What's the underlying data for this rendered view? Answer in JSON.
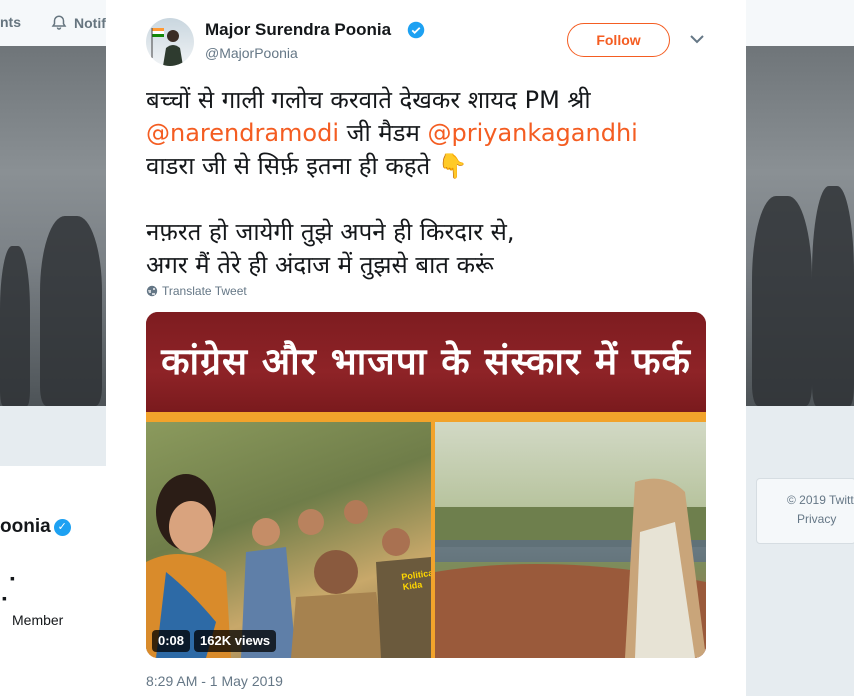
{
  "background": {
    "nav_items": [
      "nts",
      "Notifi"
    ],
    "profile_name": "oonia",
    "member_label": "Member",
    "footer_lines": [
      "© 2019 Twitt",
      "Privacy"
    ]
  },
  "tweet": {
    "display_name": "Major Surendra Poonia",
    "handle": "@MajorPoonia",
    "follow_label": "Follow",
    "text_lines": [
      {
        "pre": "बच्चों से गाली गलोच करवाते देखकर शायद  PM श्री",
        "mention": "",
        "post": ""
      },
      {
        "pre": "",
        "mention": "@narendramodi",
        "post": " जी मैडम "
      },
      {
        "pre": "वाडरा जी से सिर्फ़ इतना ही कहते ",
        "mention": "",
        "post": "👇"
      },
      {
        "pre": "",
        "mention": "",
        "post": ""
      },
      {
        "pre": "नफ़रत हो जायेगी तुझे अपने ही किरदार से,",
        "mention": "",
        "post": ""
      },
      {
        "pre": "अगर मैं तेरे ही अंदाज में तुझसे बात करूं",
        "mention": "",
        "post": ""
      }
    ],
    "mention2": "@priyankagandhi",
    "translate_label": "Translate Tweet",
    "media": {
      "banner_text": "कांग्रेस और भाजपा के संस्कार में फर्क",
      "duration": "0:08",
      "views": "162K views",
      "watermark": "Political Kida"
    },
    "timestamp": "8:29 AM - 1 May 2019"
  },
  "colors": {
    "accent": "#f45d22",
    "verified": "#1da1f2",
    "banner": "#7e1c20",
    "stripe": "#f2a32b"
  }
}
